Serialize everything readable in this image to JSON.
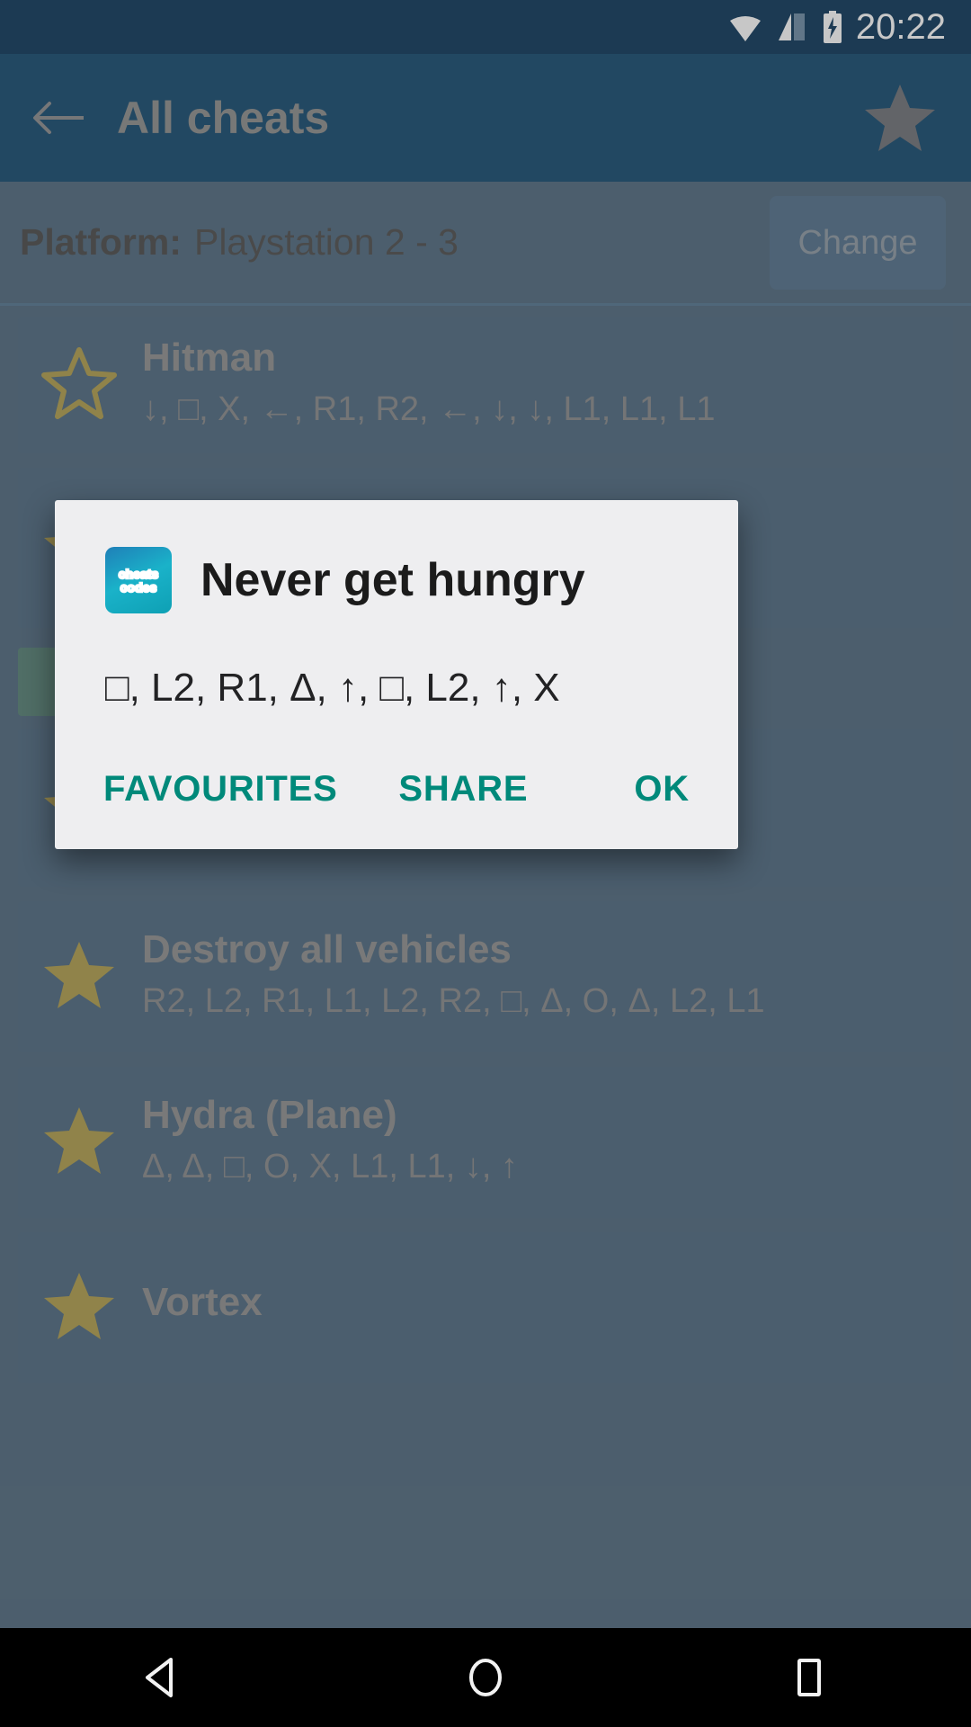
{
  "status_bar": {
    "clock": "20:22",
    "icons": [
      "wifi-icon",
      "signal-icon",
      "battery-charging-icon"
    ]
  },
  "app_bar": {
    "back_icon": "back-arrow-icon",
    "title": "All cheats",
    "favourite_icon": "star-icon"
  },
  "platform": {
    "label": "Platform:",
    "value": "Playstation 2 - 3",
    "change_label": "Change"
  },
  "cheats": [
    {
      "name": "Hitman",
      "code": "↓, □, X, ←, R1, R2, ←, ↓, ↓, L1, L1, L1",
      "starred": false
    },
    {
      "name": "",
      "code": "",
      "starred": true
    },
    {
      "name": "",
      "code": "",
      "starred": true
    },
    {
      "name": "Destroy all vehicles",
      "code": "R2, L2, R1, L1, L2, R2, □, Δ, O, Δ, L2, L1",
      "starred": true
    },
    {
      "name": "Hydra (Plane)",
      "code": "Δ, Δ, □, O, X, L1, L1, ↓, ↑",
      "starred": true
    },
    {
      "name": "Vortex",
      "code": "",
      "starred": true
    }
  ],
  "dialog": {
    "icon_line1": "cheats",
    "icon_line2": "codes",
    "title": "Never get hungry",
    "message": "□, L2, R1, Δ, ↑, □, L2, ↑, X",
    "buttons": {
      "favourites": "FAVOURITES",
      "share": "SHARE",
      "ok": "OK"
    }
  },
  "nav_bar": {
    "back": "nav-back-icon",
    "home": "nav-home-icon",
    "recents": "nav-recents-icon"
  },
  "colors": {
    "app_bar": "#14496f",
    "status_bar": "#0b3559",
    "card": "#13456e",
    "accent_teal": "#00897a",
    "star_gold": "#c9a711",
    "dialog_bg": "#eeeef0"
  }
}
